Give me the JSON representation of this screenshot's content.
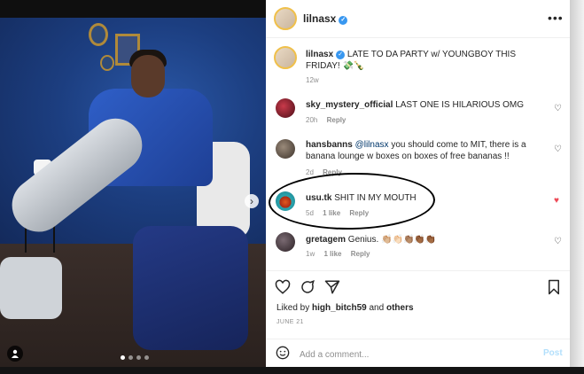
{
  "post": {
    "author": "lilnasx",
    "caption_user": "lilnasx",
    "caption_text": "LATE TO DA PARTY w/ YOUNGBOY THIS FRIDAY! 💸🍾",
    "caption_age": "12w",
    "more_label": "•••"
  },
  "comments": [
    {
      "user": "sky_mystery_official",
      "text": "LAST ONE IS HILARIOUS OMG",
      "age": "20h",
      "likes": "",
      "reply": "Reply",
      "liked": false
    },
    {
      "user": "hansbanns",
      "mention": "@lilnasx",
      "text": "you should come to MIT, there is a banana lounge w boxes on boxes of free bananas !!",
      "age": "2d",
      "likes": "",
      "reply": "Reply",
      "liked": false
    },
    {
      "user": "usu.tk",
      "text": "SHIT IN MY MOUTH",
      "age": "5d",
      "likes": "1 like",
      "reply": "Reply",
      "liked": true
    },
    {
      "user": "gretagem",
      "text": "Genius.",
      "emojis": "👏🏼👏🏻👏🏽👏🏾👏🏾",
      "age": "1w",
      "likes": "1 like",
      "reply": "Reply",
      "liked": false
    }
  ],
  "actions": {
    "liked_by_prefix": "Liked by",
    "liked_by_user": "high_bitch59",
    "liked_by_and": "and",
    "liked_by_others": "others",
    "date": "JUNE 21"
  },
  "comment_box": {
    "placeholder": "Add a comment...",
    "post_label": "Post"
  },
  "photo": {
    "next_arrow": "›",
    "user_tag_icon": "user-icon",
    "carousel_count": 4,
    "carousel_active": 1
  },
  "colors": {
    "link": "#00376b",
    "verified": "#3897f0",
    "heart_liked": "#ed4956",
    "post_button": "#b2dffc"
  }
}
